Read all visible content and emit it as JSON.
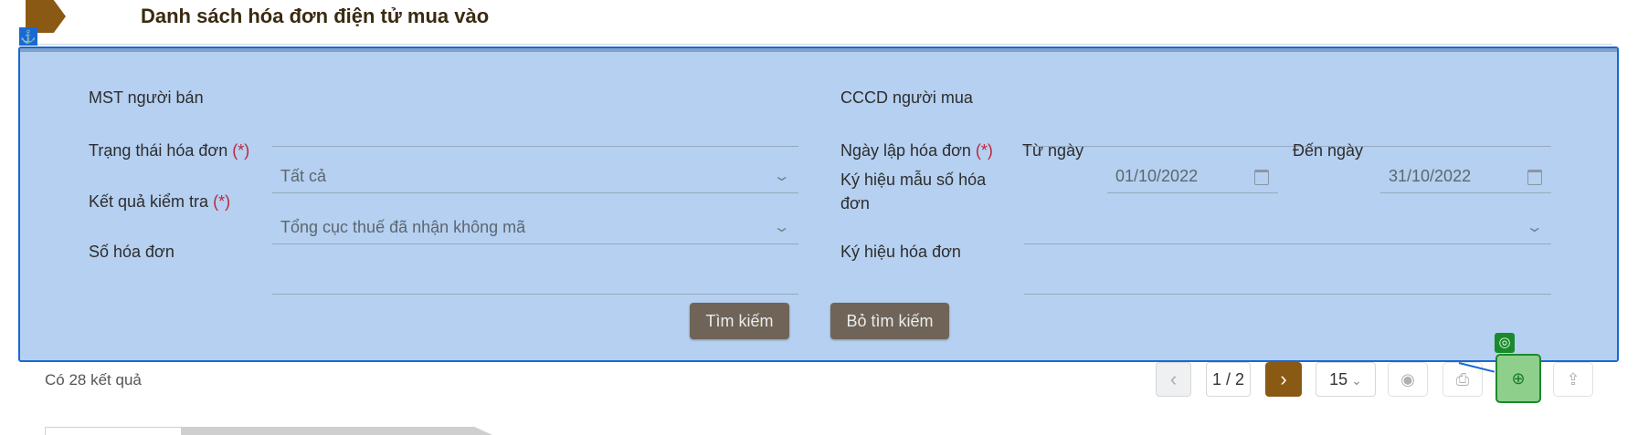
{
  "page": {
    "title": "Danh sách hóa đơn điện tử mua vào"
  },
  "overlay": {
    "anchor_icon": "anchor-icon",
    "badge_icon": "target-icon",
    "highlight_color": "#1769d6",
    "badge_color": "#1a8a2c"
  },
  "form": {
    "seller_tax_code": {
      "label": "MST người bán",
      "value": ""
    },
    "buyer_id": {
      "label": "CCCD người mua",
      "value": ""
    },
    "invoice_status": {
      "label": "Trạng thái hóa đơn",
      "required": "(*)",
      "value": "Tất cả"
    },
    "invoice_date": {
      "label": "Ngày lập hóa đơn",
      "required": "(*)",
      "from_label": "Từ ngày",
      "from_value": "01/10/2022",
      "to_label": "Đến ngày",
      "to_value": "31/10/2022"
    },
    "check_result": {
      "label": "Kết quả kiểm tra",
      "required": "(*)",
      "value": "Tổng cục thuế đã nhận không mã"
    },
    "template_symbol": {
      "label_line1": "Ký hiệu mẫu số hóa",
      "label_line2": "đơn",
      "value": ""
    },
    "invoice_number": {
      "label": "Số hóa đơn",
      "value": ""
    },
    "invoice_symbol": {
      "label": "Ký hiệu hóa đơn",
      "value": ""
    },
    "search_button": "Tìm kiếm",
    "clear_button": "Bỏ tìm kiếm"
  },
  "results": {
    "count_text": "Có 28 kết quả"
  },
  "pagination": {
    "prev_icon": "chevron-left-icon",
    "page_indicator": "1 / 2",
    "next_icon": "chevron-right-icon",
    "page_size": "15"
  },
  "toolbar": {
    "icons": [
      "view-icon",
      "print-icon",
      "target-icon",
      "export-icon"
    ]
  },
  "colors": {
    "accent": "#8a5a14",
    "button": "#6f6457",
    "panel": "#b5d0f0"
  }
}
